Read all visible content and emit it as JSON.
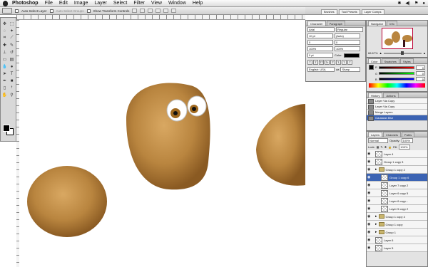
{
  "menubar": {
    "app": "Photoshop",
    "items": [
      "File",
      "Edit",
      "Image",
      "Layer",
      "Select",
      "Filter",
      "View",
      "Window",
      "Help"
    ],
    "clock": "",
    "right_icons": [
      "bluetooth-icon",
      "volume-icon",
      "flag-icon",
      "spotlight-icon"
    ]
  },
  "options": {
    "auto_select_layer": "Auto Select Layer",
    "auto_select_groups": "Auto Select Groups",
    "show_transform": "Show Transform Controls"
  },
  "well_tabs": [
    "Brushes",
    "Tool Presets",
    "Layer Comps"
  ],
  "character": {
    "tabs": [
      "Character",
      "Paragraph"
    ],
    "font": "Arial",
    "style": "Regular",
    "size": "10 pt",
    "leading": "(Auto)",
    "kerning": "0",
    "tracking": "0",
    "vscale": "100%",
    "hscale": "100%",
    "baseline": "0 pt",
    "color_label": "Color:",
    "language": "English: USA",
    "anti_alias": "Sharp",
    "aa_label": "aa",
    "style_buttons": [
      "T",
      "T",
      "TT",
      "Tr",
      "T'",
      "T,",
      "T",
      "T"
    ]
  },
  "navigator": {
    "tabs": [
      "Navigator",
      "Info"
    ],
    "zoom": "66.67%"
  },
  "color": {
    "tabs": [
      "Color",
      "Swatches",
      "Styles"
    ],
    "channels": [
      {
        "label": "R",
        "value": "0"
      },
      {
        "label": "G",
        "value": "0"
      },
      {
        "label": "B",
        "value": "0"
      }
    ]
  },
  "history": {
    "tabs": [
      "History",
      "Actions"
    ],
    "items": [
      "Layer Via Copy",
      "Layer Via Copy",
      "Merge Layers",
      "Gaussian Blur"
    ],
    "selected": 3
  },
  "layers": {
    "tabs": [
      "Layers",
      "Channels",
      "Paths"
    ],
    "blend_mode": "Normal",
    "opacity_label": "Opacity:",
    "opacity": "100%",
    "lock_label": "Lock:",
    "fill_label": "Fill:",
    "fill": "100%",
    "items": [
      {
        "name": "Layer 4",
        "type": "layer",
        "indent": 0
      },
      {
        "name": "Group 1 copy 3",
        "type": "layer",
        "indent": 0
      },
      {
        "name": "Group 1 copy 2",
        "type": "group",
        "indent": 0
      },
      {
        "name": "Group 1 copy 6",
        "type": "layer",
        "indent": 1,
        "selected": true
      },
      {
        "name": "Layer 7 copy 2",
        "type": "layer",
        "indent": 1
      },
      {
        "name": "Layer 6 copy 5",
        "type": "layer",
        "indent": 1
      },
      {
        "name": "Layer 6 copy...",
        "type": "layer",
        "indent": 1
      },
      {
        "name": "Layer 5 copy 2",
        "type": "layer",
        "indent": 1
      },
      {
        "name": "Group 1 copy 4",
        "type": "group",
        "indent": 0
      },
      {
        "name": "Group 1 copy",
        "type": "group",
        "indent": 0
      },
      {
        "name": "Group 1",
        "type": "group",
        "indent": 0
      },
      {
        "name": "Layer 6",
        "type": "layer",
        "indent": 0
      },
      {
        "name": "Layer 5",
        "type": "layer",
        "indent": 0
      }
    ]
  },
  "colors": {
    "bread": "#b9853f",
    "bread_dark": "#8a5a22",
    "selection": "#3b63b3",
    "handle": "#3a1218"
  }
}
